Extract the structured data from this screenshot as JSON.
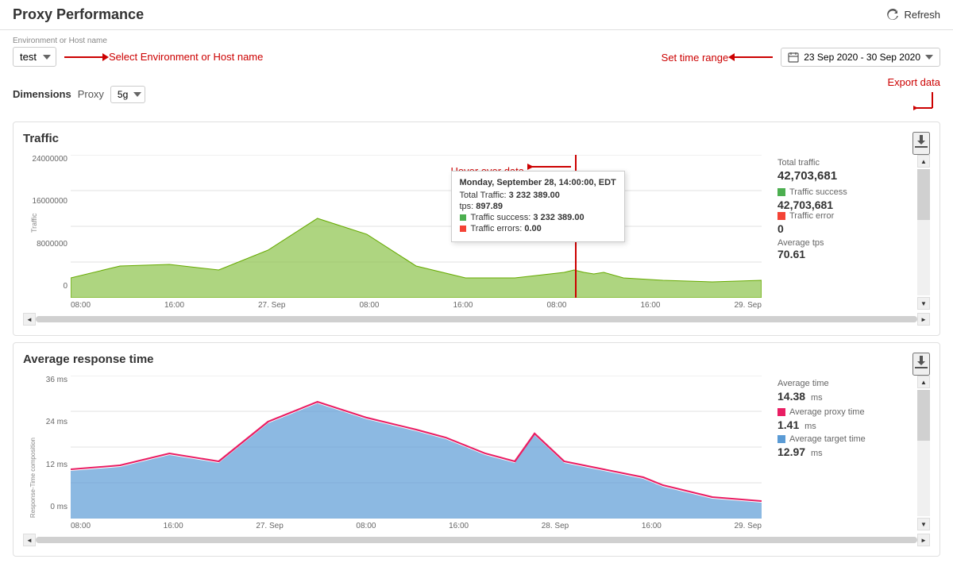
{
  "header": {
    "title": "Proxy Performance",
    "refresh_label": "Refresh"
  },
  "controls": {
    "env_label": "Environment or Host name",
    "env_value": "test",
    "env_annotation": "Select Environment or Host name",
    "time_range_annotation": "Set time range",
    "time_range_value": "23 Sep 2020 - 30 Sep 2020"
  },
  "dimensions": {
    "label": "Dimensions",
    "proxy_label": "Proxy",
    "proxy_value": "5g",
    "export_label": "Export data"
  },
  "traffic_chart": {
    "title": "Traffic",
    "y_labels": [
      "24000000",
      "16000000",
      "8000000",
      "0"
    ],
    "x_labels": [
      "08:00",
      "16:00",
      "27. Sep",
      "08:00",
      "16:00",
      "08:00",
      "16:00",
      "29. Sep"
    ],
    "tooltip": {
      "title": "Monday, September 28, 14:00:00, EDT",
      "total_traffic_label": "Total Traffic:",
      "total_traffic_value": "3 232 389.00",
      "tps_label": "tps:",
      "tps_value": "897.89",
      "success_label": "Traffic success:",
      "success_value": "3 232 389.00",
      "errors_label": "Traffic errors:",
      "errors_value": "0.00"
    },
    "hover_annotation": "Hover over data",
    "stats": {
      "total_label": "Total traffic",
      "total_value": "42,703,681",
      "success_label": "Traffic success",
      "success_value": "42,703,681",
      "error_label": "Traffic error",
      "error_value": "0",
      "avg_tps_label": "Average tps",
      "avg_tps_value": "70.61"
    }
  },
  "response_chart": {
    "title": "Average response time",
    "y_labels": [
      "36 ms",
      "24 ms",
      "12 ms",
      "0 ms"
    ],
    "x_labels": [
      "08:00",
      "16:00",
      "27. Sep",
      "08:00",
      "16:00",
      "28. Sep",
      "16:00",
      "29. Sep"
    ],
    "y_axis_title": "Response-Time composition",
    "stats": {
      "avg_time_label": "Average time",
      "avg_time_value": "14.38",
      "avg_time_unit": "ms",
      "proxy_label": "Average proxy time",
      "proxy_value": "1.41",
      "proxy_unit": "ms",
      "target_label": "Average target time",
      "target_value": "12.97",
      "target_unit": "ms"
    }
  }
}
